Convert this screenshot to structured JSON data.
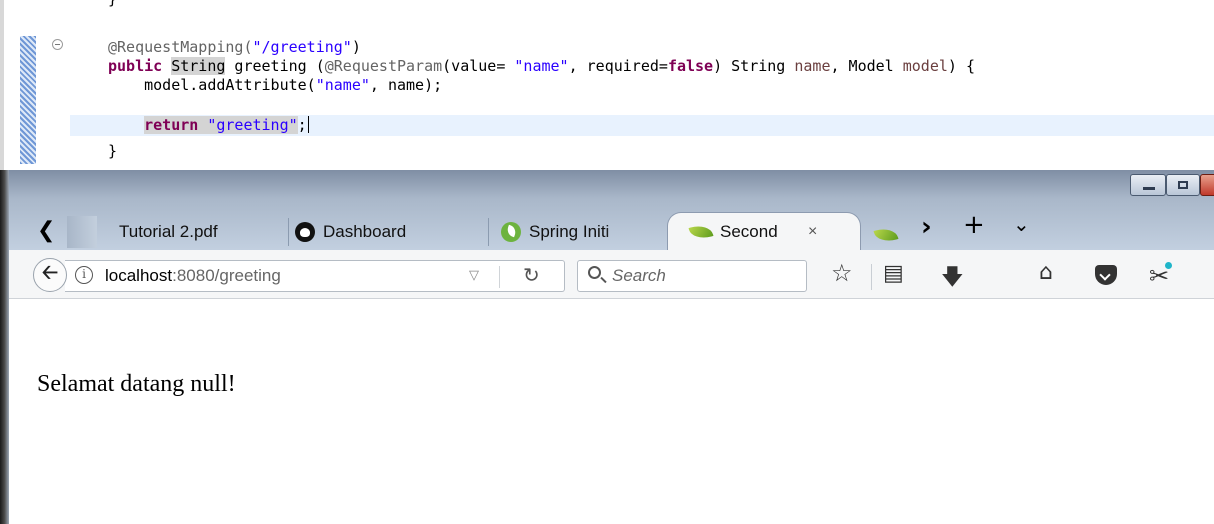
{
  "editor": {
    "line_brace_top": "}",
    "annotation": "@RequestMapping(",
    "annotation_arg": "\"/greeting\"",
    "annotation_close": ")",
    "sig_public": "public",
    "sig_string": "String",
    "sig_name": " greeting (",
    "sig_reqparam": "@RequestParam",
    "sig_value": "(value= ",
    "sig_name_str": "\"name\"",
    "sig_required": ", required=",
    "sig_false": "false",
    "sig_rest1": ") String ",
    "sig_param_name": "name",
    "sig_rest2": ", Model ",
    "sig_param_model": "model",
    "sig_rest3": ") {",
    "body1_a": "model.addAttribute(",
    "body1_str": "\"name\"",
    "body1_b": ", name);",
    "body2_kw": "return",
    "body2_str": "\"greeting\"",
    "body2_end": ";",
    "line_brace_bottom": "}"
  },
  "browser": {
    "tabs": [
      {
        "label": "Tutorial 2.pdf",
        "icon": "pdf-icon"
      },
      {
        "label": "Dashboard",
        "icon": "github-icon"
      },
      {
        "label": "Spring Initi",
        "icon": "spring-icon"
      },
      {
        "label": "Second",
        "icon": "leaf-icon",
        "active": true
      }
    ],
    "tab_close_glyph": "×",
    "overflow_tab_icon": "leaf-icon",
    "nav": {
      "url_host": "localhost",
      "url_rest": ":8080/greeting",
      "search_placeholder": "Search"
    },
    "page_text": "Selamat datang null!"
  },
  "colors": {
    "keyword": "#7f0055",
    "string": "#2a00ff",
    "annotation": "#646464",
    "current_line": "#e8f2fe"
  }
}
